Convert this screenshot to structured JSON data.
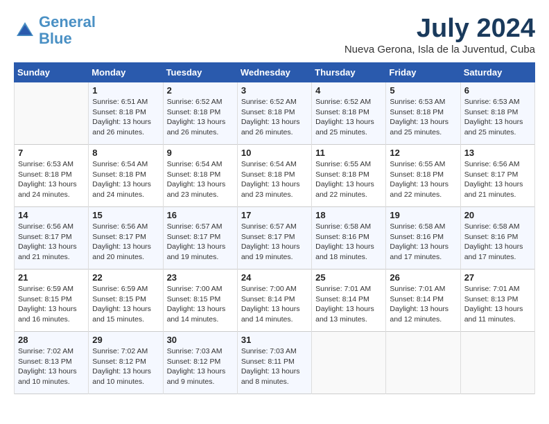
{
  "header": {
    "logo_line1": "General",
    "logo_line2": "Blue",
    "month_year": "July 2024",
    "location": "Nueva Gerona, Isla de la Juventud, Cuba"
  },
  "weekdays": [
    "Sunday",
    "Monday",
    "Tuesday",
    "Wednesday",
    "Thursday",
    "Friday",
    "Saturday"
  ],
  "weeks": [
    [
      {
        "day": "",
        "info": ""
      },
      {
        "day": "1",
        "info": "Sunrise: 6:51 AM\nSunset: 8:18 PM\nDaylight: 13 hours\nand 26 minutes."
      },
      {
        "day": "2",
        "info": "Sunrise: 6:52 AM\nSunset: 8:18 PM\nDaylight: 13 hours\nand 26 minutes."
      },
      {
        "day": "3",
        "info": "Sunrise: 6:52 AM\nSunset: 8:18 PM\nDaylight: 13 hours\nand 26 minutes."
      },
      {
        "day": "4",
        "info": "Sunrise: 6:52 AM\nSunset: 8:18 PM\nDaylight: 13 hours\nand 25 minutes."
      },
      {
        "day": "5",
        "info": "Sunrise: 6:53 AM\nSunset: 8:18 PM\nDaylight: 13 hours\nand 25 minutes."
      },
      {
        "day": "6",
        "info": "Sunrise: 6:53 AM\nSunset: 8:18 PM\nDaylight: 13 hours\nand 25 minutes."
      }
    ],
    [
      {
        "day": "7",
        "info": "Sunrise: 6:53 AM\nSunset: 8:18 PM\nDaylight: 13 hours\nand 24 minutes."
      },
      {
        "day": "8",
        "info": "Sunrise: 6:54 AM\nSunset: 8:18 PM\nDaylight: 13 hours\nand 24 minutes."
      },
      {
        "day": "9",
        "info": "Sunrise: 6:54 AM\nSunset: 8:18 PM\nDaylight: 13 hours\nand 23 minutes."
      },
      {
        "day": "10",
        "info": "Sunrise: 6:54 AM\nSunset: 8:18 PM\nDaylight: 13 hours\nand 23 minutes."
      },
      {
        "day": "11",
        "info": "Sunrise: 6:55 AM\nSunset: 8:18 PM\nDaylight: 13 hours\nand 22 minutes."
      },
      {
        "day": "12",
        "info": "Sunrise: 6:55 AM\nSunset: 8:18 PM\nDaylight: 13 hours\nand 22 minutes."
      },
      {
        "day": "13",
        "info": "Sunrise: 6:56 AM\nSunset: 8:17 PM\nDaylight: 13 hours\nand 21 minutes."
      }
    ],
    [
      {
        "day": "14",
        "info": "Sunrise: 6:56 AM\nSunset: 8:17 PM\nDaylight: 13 hours\nand 21 minutes."
      },
      {
        "day": "15",
        "info": "Sunrise: 6:56 AM\nSunset: 8:17 PM\nDaylight: 13 hours\nand 20 minutes."
      },
      {
        "day": "16",
        "info": "Sunrise: 6:57 AM\nSunset: 8:17 PM\nDaylight: 13 hours\nand 19 minutes."
      },
      {
        "day": "17",
        "info": "Sunrise: 6:57 AM\nSunset: 8:17 PM\nDaylight: 13 hours\nand 19 minutes."
      },
      {
        "day": "18",
        "info": "Sunrise: 6:58 AM\nSunset: 8:16 PM\nDaylight: 13 hours\nand 18 minutes."
      },
      {
        "day": "19",
        "info": "Sunrise: 6:58 AM\nSunset: 8:16 PM\nDaylight: 13 hours\nand 17 minutes."
      },
      {
        "day": "20",
        "info": "Sunrise: 6:58 AM\nSunset: 8:16 PM\nDaylight: 13 hours\nand 17 minutes."
      }
    ],
    [
      {
        "day": "21",
        "info": "Sunrise: 6:59 AM\nSunset: 8:15 PM\nDaylight: 13 hours\nand 16 minutes."
      },
      {
        "day": "22",
        "info": "Sunrise: 6:59 AM\nSunset: 8:15 PM\nDaylight: 13 hours\nand 15 minutes."
      },
      {
        "day": "23",
        "info": "Sunrise: 7:00 AM\nSunset: 8:15 PM\nDaylight: 13 hours\nand 14 minutes."
      },
      {
        "day": "24",
        "info": "Sunrise: 7:00 AM\nSunset: 8:14 PM\nDaylight: 13 hours\nand 14 minutes."
      },
      {
        "day": "25",
        "info": "Sunrise: 7:01 AM\nSunset: 8:14 PM\nDaylight: 13 hours\nand 13 minutes."
      },
      {
        "day": "26",
        "info": "Sunrise: 7:01 AM\nSunset: 8:14 PM\nDaylight: 13 hours\nand 12 minutes."
      },
      {
        "day": "27",
        "info": "Sunrise: 7:01 AM\nSunset: 8:13 PM\nDaylight: 13 hours\nand 11 minutes."
      }
    ],
    [
      {
        "day": "28",
        "info": "Sunrise: 7:02 AM\nSunset: 8:13 PM\nDaylight: 13 hours\nand 10 minutes."
      },
      {
        "day": "29",
        "info": "Sunrise: 7:02 AM\nSunset: 8:12 PM\nDaylight: 13 hours\nand 10 minutes."
      },
      {
        "day": "30",
        "info": "Sunrise: 7:03 AM\nSunset: 8:12 PM\nDaylight: 13 hours\nand 9 minutes."
      },
      {
        "day": "31",
        "info": "Sunrise: 7:03 AM\nSunset: 8:11 PM\nDaylight: 13 hours\nand 8 minutes."
      },
      {
        "day": "",
        "info": ""
      },
      {
        "day": "",
        "info": ""
      },
      {
        "day": "",
        "info": ""
      }
    ]
  ]
}
